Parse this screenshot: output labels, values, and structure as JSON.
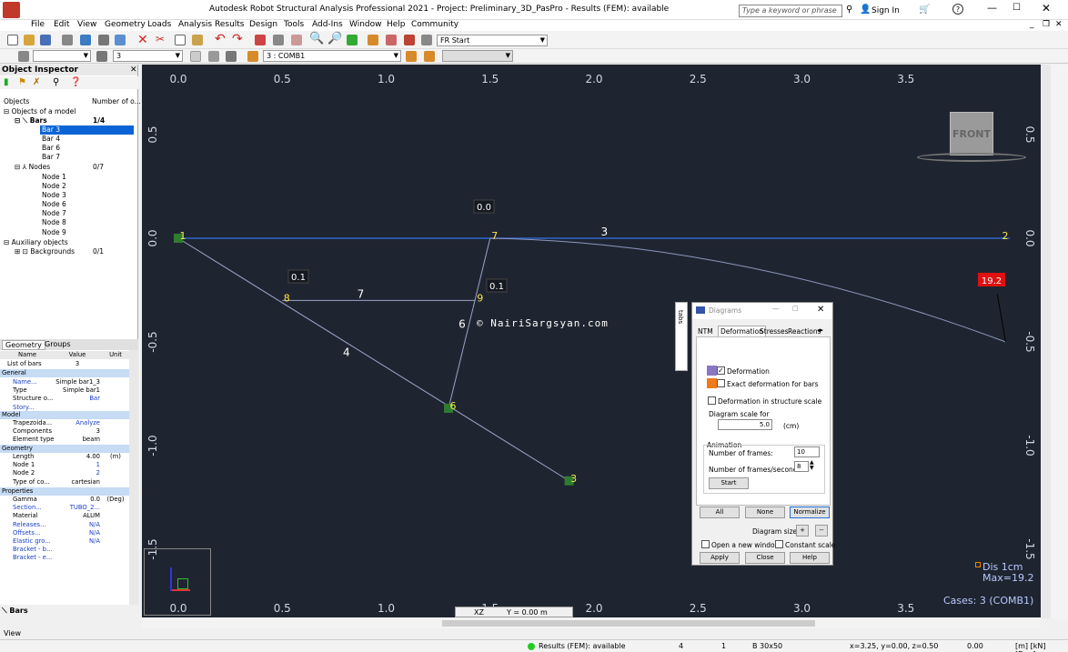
{
  "app": {
    "title": "Autodesk Robot Structural Analysis Professional 2021 - Project: Preliminary_3D_PasPro - Results (FEM): available",
    "search_placeholder": "Type a keyword or phrase",
    "sign_in": "Sign In"
  },
  "menu": [
    "File",
    "Edit",
    "View",
    "Geometry",
    "Loads",
    "Analysis",
    "Results",
    "Design",
    "Tools",
    "Add-Ins",
    "Window",
    "Help",
    "Community"
  ],
  "toolbar": {
    "layout_combo": "Start",
    "layout_combo_prefix": "FR",
    "bar_selection": "3",
    "case_combo": "3 : COMB1"
  },
  "object_inspector": {
    "title": "Object Inspector",
    "col_objects": "Objects",
    "col_number": "Number of o...",
    "root": "Objects of a model",
    "bars_label": "Bars",
    "bars_count": "1/4",
    "bars": [
      "Bar    3",
      "Bar    4",
      "Bar    6",
      "Bar    7"
    ],
    "nodes_label": "Nodes",
    "nodes_count": "0/7",
    "nodes": [
      "Node   1",
      "Node   2",
      "Node   3",
      "Node   6",
      "Node   7",
      "Node   8",
      "Node   9"
    ],
    "aux_label": "Auxiliary objects",
    "backgrounds_label": "Backgrounds",
    "backgrounds_count": "0/1"
  },
  "panel_tabs": {
    "geometry": "Geometry",
    "groups": "Groups"
  },
  "properties": {
    "headers": {
      "name": "Name",
      "value": "Value",
      "unit": "Unit"
    },
    "list_of_bars_label": "List of bars",
    "list_of_bars_value": "3",
    "general": "General",
    "rows_general": [
      {
        "n": "Name...",
        "v": "Simple bar1_3",
        "u": ""
      },
      {
        "n": "Type",
        "v": "Simple bar1",
        "u": ""
      },
      {
        "n": "Structure o...",
        "v": "Bar",
        "u": ""
      },
      {
        "n": "Story...",
        "v": "",
        "u": ""
      }
    ],
    "model": "Model",
    "rows_model": [
      {
        "n": "Trapezoida...",
        "v": "Analyze",
        "u": ""
      },
      {
        "n": "Components",
        "v": "3",
        "u": ""
      },
      {
        "n": "Element type",
        "v": "beam",
        "u": ""
      }
    ],
    "geometry": "Geometry",
    "rows_geometry": [
      {
        "n": "Length",
        "v": "4.00",
        "u": "(m)"
      },
      {
        "n": "Node 1",
        "v": "1",
        "u": ""
      },
      {
        "n": "Node 2",
        "v": "2",
        "u": ""
      },
      {
        "n": "Type of co...",
        "v": "cartesian",
        "u": ""
      }
    ],
    "props": "Properties",
    "rows_props": [
      {
        "n": "Gamma",
        "v": "0.0",
        "u": "(Deg)"
      },
      {
        "n": "Section...",
        "v": "TUBO_2...",
        "u": ""
      },
      {
        "n": "Material",
        "v": "ALUM",
        "u": ""
      },
      {
        "n": "Releases...",
        "v": "N/A",
        "u": ""
      },
      {
        "n": "Offsets...",
        "v": "N/A",
        "u": ""
      },
      {
        "n": "Elastic gro...",
        "v": "N/A",
        "u": ""
      },
      {
        "n": "Bracket - b...",
        "v": "",
        "u": ""
      },
      {
        "n": "Bracket - e...",
        "v": "",
        "u": ""
      }
    ],
    "bottom_tab": "Bars"
  },
  "viewport": {
    "top_ticks": [
      "0.0",
      "0.5",
      "1.0",
      "1.5",
      "2.0",
      "2.5",
      "3.0",
      "3.5"
    ],
    "bottom_ticks": [
      "0.0",
      "0.5",
      "1.0",
      "1.5",
      "2.0",
      "2.5",
      "3.0",
      "3.5"
    ],
    "left_ticks": [
      "0.5",
      "0.0",
      "-0.5",
      "-1.0",
      "-1.5"
    ],
    "right_ticks": [
      "0.5",
      "0.0",
      "-0.5",
      "-1.0",
      "-1.5"
    ],
    "nodes": [
      {
        "id": "1",
        "x": 0.0,
        "y": 0.0
      },
      {
        "id": "2",
        "x": 4.0,
        "y": 0.0
      },
      {
        "id": "3",
        "x": 1.88,
        "y": -1.17
      },
      {
        "id": "6",
        "x": 1.3,
        "y": -0.82
      },
      {
        "id": "7",
        "x": 1.5,
        "y": 0.0
      },
      {
        "id": "8",
        "x": 0.5,
        "y": -0.3
      },
      {
        "id": "9",
        "x": 1.43,
        "y": -0.3
      }
    ],
    "bars": [
      {
        "id": "3",
        "from": "1",
        "to": "2"
      },
      {
        "id": "4",
        "from": "1",
        "to": "3"
      },
      {
        "id": "6",
        "from": "7",
        "to": "6"
      },
      {
        "id": "7",
        "from": "8",
        "to": "9"
      }
    ],
    "value_labels": [
      "0.0",
      "0.1",
      "0.1",
      "19.2"
    ],
    "watermark": "© NairiSargsyan.com",
    "view_cube_label": "FRONT",
    "legend_dis": "Dis   1cm",
    "legend_max": "Max=19.2",
    "cases": "Cases: 3 (COMB1)",
    "view_plane": "XZ",
    "view_coord": "Y = 0.00 m",
    "colors": {
      "background": "#1f2530",
      "bar": "#2f63c9",
      "deform": "#8d98bf",
      "label_red": "#e01010",
      "node": "#2e7d2e"
    }
  },
  "diagrams": {
    "title": "Diagrams",
    "side_tab": "tabs",
    "tabs": [
      "NTM",
      "Deformation",
      "Stresses",
      "Reactions"
    ],
    "deformation": "Deformation",
    "exact": "Exact deformation for bars",
    "in_scale": "Deformation in structure scale",
    "scale_label": "Diagram scale for",
    "scale_value": "5.0",
    "scale_unit": "(cm)",
    "animation": "Animation",
    "frames_label": "Number of frames:",
    "frames_value": "10",
    "fps_label": "Number of frames/second:",
    "fps_value": "8",
    "start": "Start",
    "all": "All",
    "none": "None",
    "normalize": "Normalize",
    "diagram_size": "Diagram size:",
    "plus": "+",
    "minus": "--",
    "open_new": "Open a new window",
    "constant": "Constant scale",
    "apply": "Apply",
    "close": "Close",
    "help": "Help"
  },
  "status": {
    "view": "View",
    "results": "Results (FEM): available",
    "n1": "4",
    "n2": "1",
    "section": "B 30x50",
    "coords": "x=3.25, y=0.00, z=0.50",
    "angle": "0.00",
    "units": "[m] [kN] [Deg]"
  }
}
